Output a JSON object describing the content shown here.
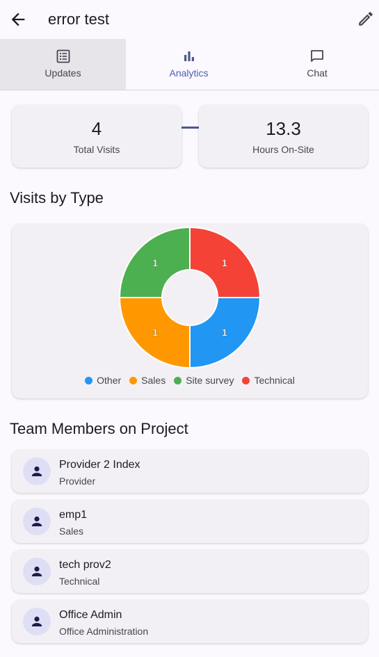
{
  "appbar": {
    "title": "error test",
    "back_icon": "arrow-back-icon",
    "edit_icon": "pencil-icon"
  },
  "tabs": [
    {
      "label": "Updates",
      "icon": "list-alt-icon",
      "selected": false
    },
    {
      "label": "Analytics",
      "icon": "bar-chart-icon",
      "selected": true
    },
    {
      "label": "Chat",
      "icon": "chat-bubble-icon",
      "selected": false
    }
  ],
  "stats": [
    {
      "value": "4",
      "label": "Total Visits"
    },
    {
      "value": "13.3",
      "label": "Hours On-Site"
    }
  ],
  "sections": {
    "visits_title": "Visits by Type",
    "team_title": "Team Members on Project"
  },
  "chart_data": {
    "type": "pie",
    "donut": true,
    "categories": [
      "Other",
      "Sales",
      "Site survey",
      "Technical"
    ],
    "values": [
      1,
      1,
      1,
      1
    ],
    "colors": [
      "#2196f3",
      "#ff9800",
      "#4caf50",
      "#f44336"
    ],
    "legend": "bottom"
  },
  "team": [
    {
      "name": "Provider 2 Index",
      "role": "Provider"
    },
    {
      "name": "emp1",
      "role": "Sales"
    },
    {
      "name": "tech prov2",
      "role": "Technical"
    },
    {
      "name": "Office Admin",
      "role": "Office Administration"
    }
  ],
  "colors": {
    "background": "#fbf8fe",
    "card": "#f3f0f5",
    "accent": "#4a5fb0",
    "avatar": "#dedff5"
  }
}
